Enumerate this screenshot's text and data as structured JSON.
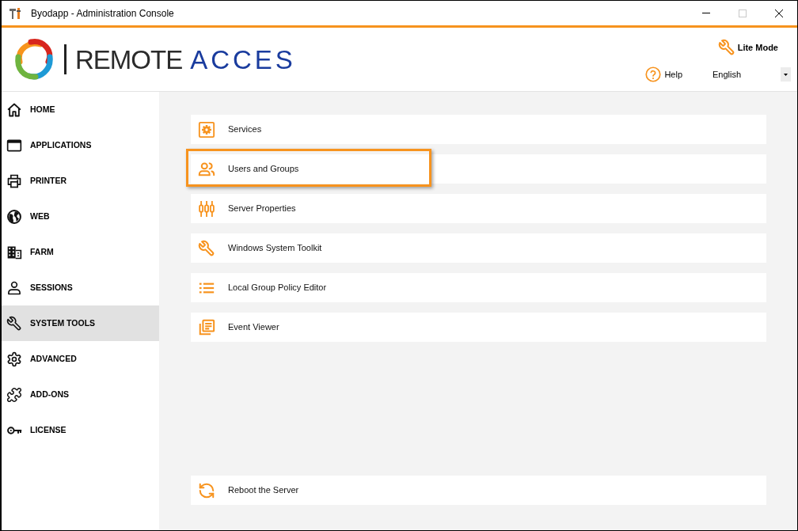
{
  "window": {
    "title": "Byodapp - Administration Console",
    "maximize_disabled": true
  },
  "header": {
    "logo": {
      "word_1": "REMOTE",
      "word_2": "ACCES"
    },
    "lite_mode": "Lite Mode",
    "help": "Help",
    "language_select": {
      "value": "English"
    }
  },
  "sidebar": {
    "items": [
      {
        "label": "HOME",
        "selected": false
      },
      {
        "label": "APPLICATIONS",
        "selected": false
      },
      {
        "label": "PRINTER",
        "selected": false
      },
      {
        "label": "WEB",
        "selected": false
      },
      {
        "label": "FARM",
        "selected": false
      },
      {
        "label": "SESSIONS",
        "selected": false
      },
      {
        "label": "SYSTEM TOOLS",
        "selected": true
      },
      {
        "label": "ADVANCED",
        "selected": false
      },
      {
        "label": "ADD-ONS",
        "selected": false
      },
      {
        "label": "LICENSE",
        "selected": false
      }
    ]
  },
  "tools": [
    {
      "label": "Services",
      "highlighted": false
    },
    {
      "label": "Users and Groups",
      "highlighted": true
    },
    {
      "label": "Server Properties",
      "highlighted": false
    },
    {
      "label": "Windows System Toolkit",
      "highlighted": false
    },
    {
      "label": "Local Group Policy Editor",
      "highlighted": false
    },
    {
      "label": "Event Viewer",
      "highlighted": false
    }
  ],
  "bottom_action": {
    "label": "Reboot the Server"
  }
}
